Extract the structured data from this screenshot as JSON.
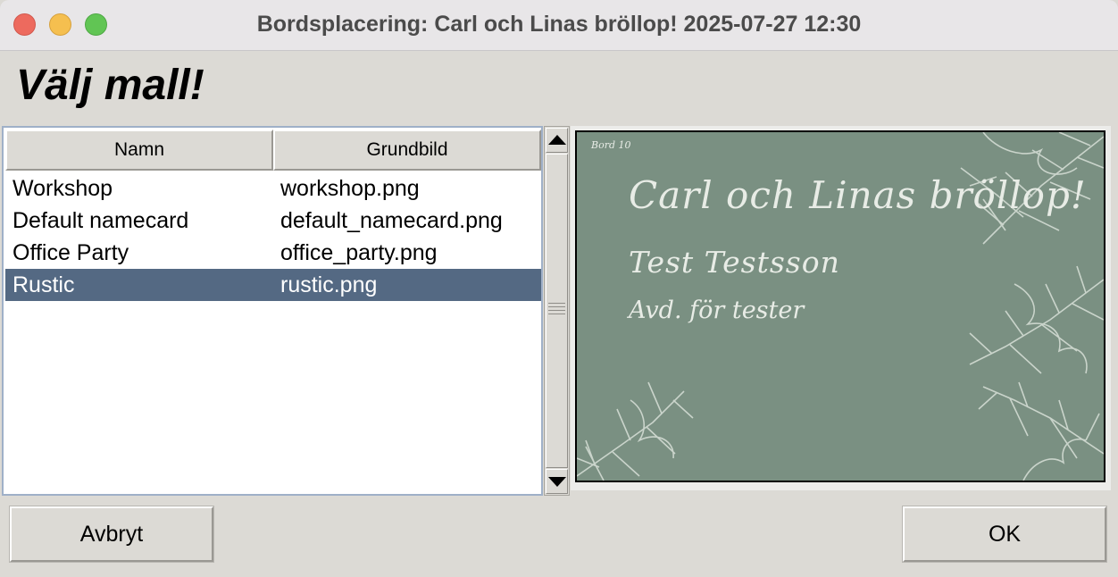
{
  "window": {
    "title": "Bordsplacering: Carl och Linas bröllop! 2025-07-27 12:30"
  },
  "heading": "Välj mall!",
  "table": {
    "columns": [
      "Namn",
      "Grundbild"
    ],
    "rows": [
      {
        "name": "Workshop",
        "image": "workshop.png"
      },
      {
        "name": "Default namecard",
        "image": "default_namecard.png"
      },
      {
        "name": "Office Party",
        "image": "office_party.png"
      },
      {
        "name": "Rustic",
        "image": "rustic.png"
      }
    ],
    "selected_index": 3
  },
  "preview": {
    "table_label": "Bord 10",
    "event_title": "Carl och Linas bröllop!",
    "guest_name": "Test Testsson",
    "department": "Avd. för tester",
    "background_color": "#7a9082",
    "text_color": "#e8ece6"
  },
  "buttons": {
    "cancel": "Avbryt",
    "ok": "OK"
  },
  "colors": {
    "selection": "#546983",
    "dialog_bg": "#dcdad5"
  }
}
